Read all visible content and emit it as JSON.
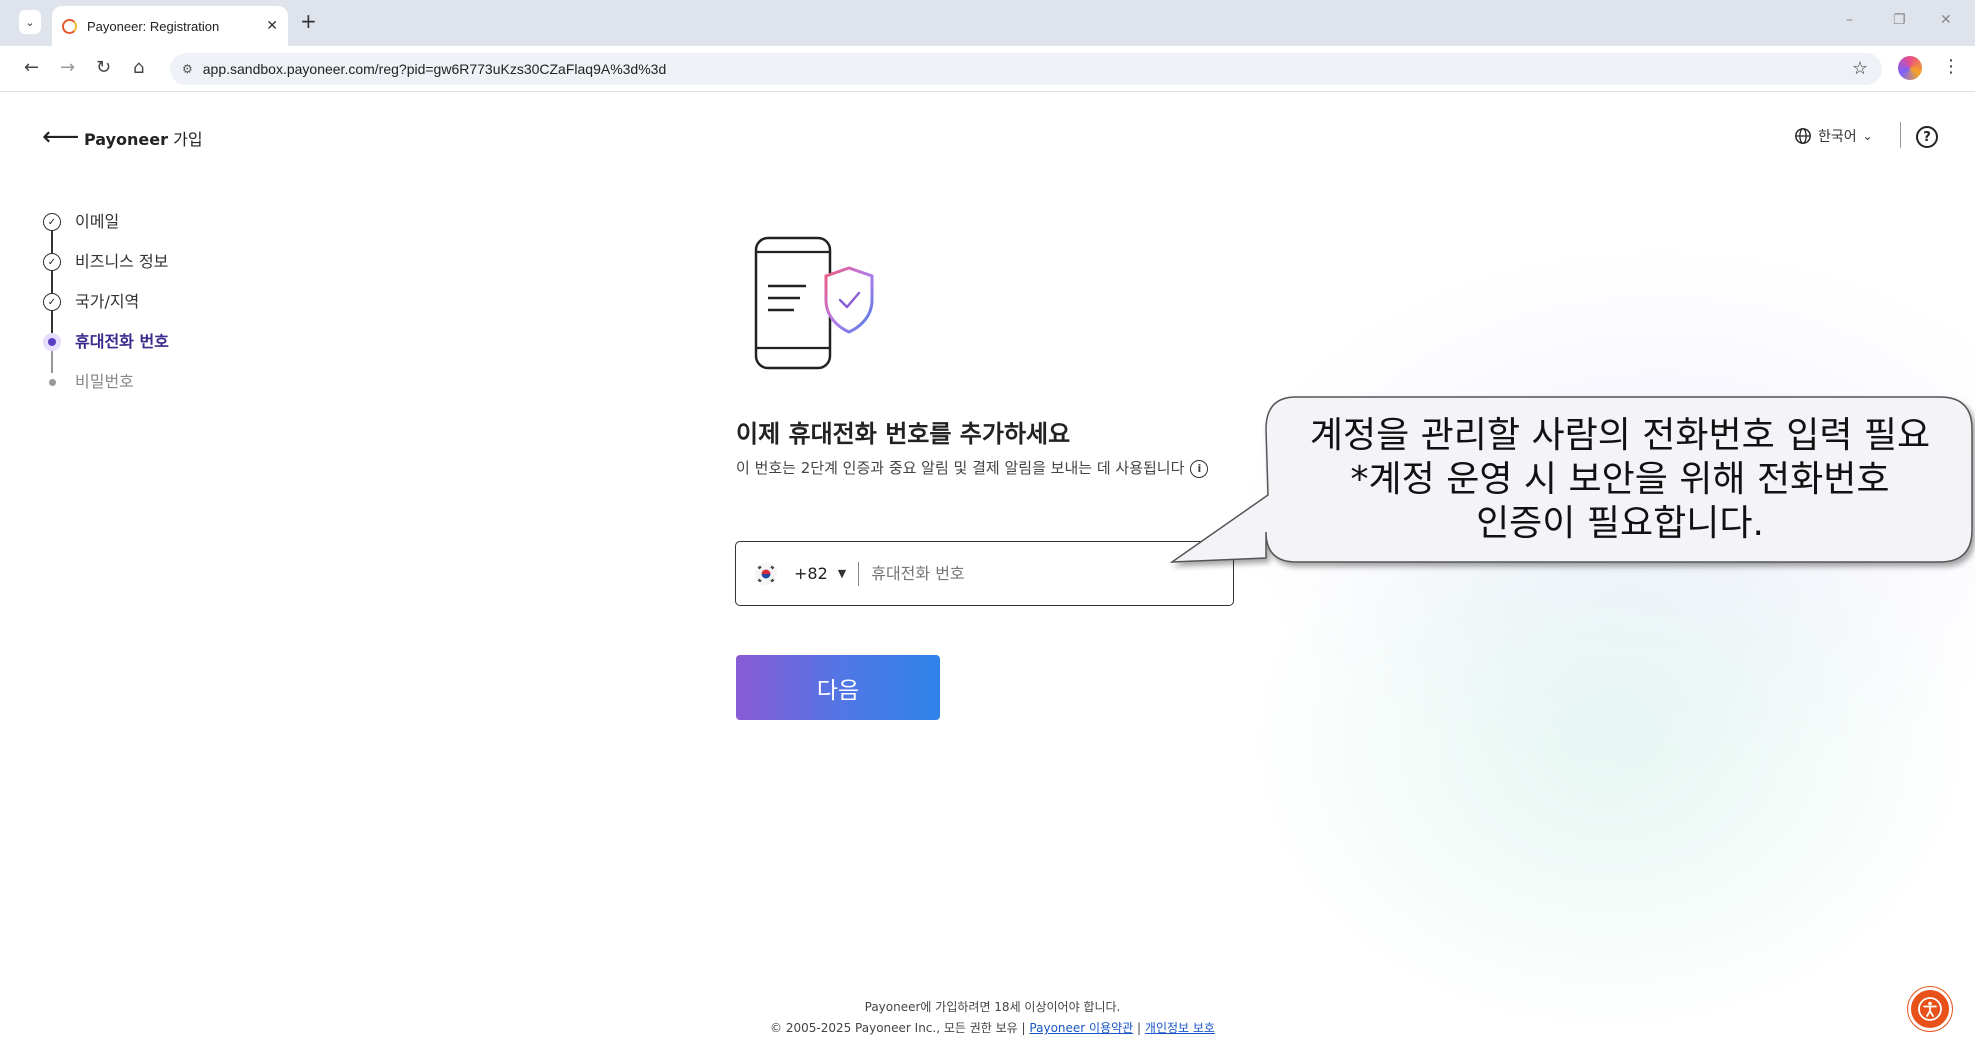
{
  "browser": {
    "tab_title": "Payoneer: Registration",
    "tab_close": "✕",
    "new_tab": "+",
    "url": "app.sandbox.payoneer.com/reg?pid=gw6R773uKzs30CZaFlaq9A%3d%3d",
    "window_controls": [
      "–",
      "❐",
      "✕"
    ]
  },
  "header": {
    "brand": "Payoneer",
    "title_suffix": " 가입",
    "language": "한국어",
    "help": "?"
  },
  "steps": [
    {
      "label": "이메일",
      "state": "done"
    },
    {
      "label": "비즈니스 정보",
      "state": "done"
    },
    {
      "label": "국가/지역",
      "state": "done"
    },
    {
      "label": "휴대전화 번호",
      "state": "current"
    },
    {
      "label": "비밀번호",
      "state": "pending"
    }
  ],
  "main": {
    "title": "이제 휴대전화 번호를 추가하세요",
    "subtitle": "이 번호는 2단계 인증과 중요 알림 및 결제 알림을 보내는 데 사용됩니다",
    "info": "i",
    "dial_code": "+82",
    "phone_placeholder": "휴대전화 번호",
    "next_label": "다음"
  },
  "callout": {
    "line1": "계정을 관리할 사람의 전화번호 입력 필요",
    "line2": "*계정 운영 시 보안을 위해 전화번호",
    "line3": "인증이 필요합니다."
  },
  "footer": {
    "age_notice": "Payoneer에 가입하려면 18세 이상이어야 합니다.",
    "copyright": "© 2005-2025 Payoneer Inc., 모든 권한 보유 |",
    "terms_link": "Payoneer 이용약관",
    "separator": "|",
    "privacy_link": "개인정보 보호"
  },
  "colors": {
    "accent_purple": "#5a3fc0",
    "button_gradient_start": "#8a5bd6",
    "button_gradient_end": "#2f82e8",
    "accessibility_button": "#e8521a"
  }
}
